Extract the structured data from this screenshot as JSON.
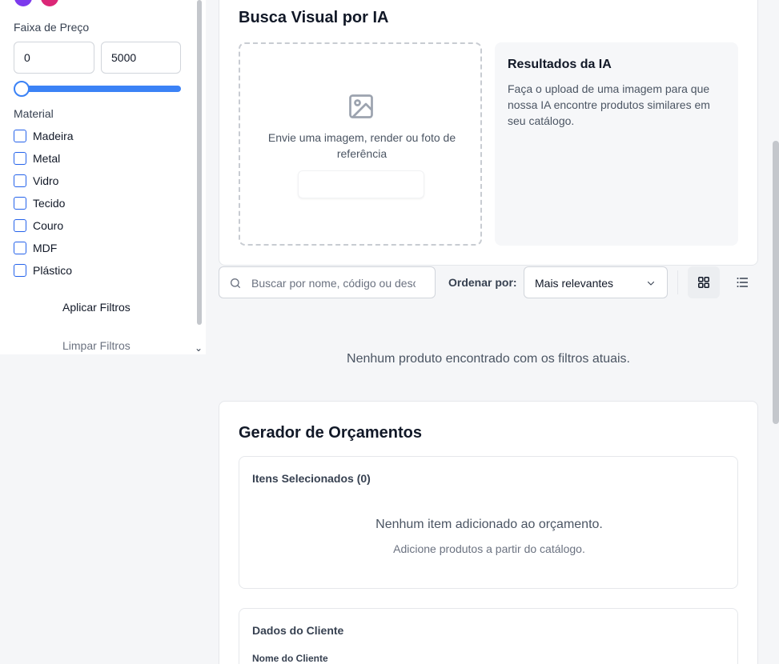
{
  "sidebar": {
    "price_range_label": "Faixa de Preço",
    "price_min": "0",
    "price_max": "5000",
    "price_slider_position": 0,
    "material_label": "Material",
    "materials": [
      "Madeira",
      "Metal",
      "Vidro",
      "Tecido",
      "Couro",
      "MDF",
      "Plástico"
    ],
    "apply_button": "Aplicar Filtros",
    "clear_button": "Limpar Filtros",
    "swatch_colors": [
      "#7c3aed",
      "#db2777"
    ]
  },
  "ai_search": {
    "title": "Busca Visual por IA",
    "upload_text": "Envie uma imagem, render ou foto de referência",
    "results_title": "Resultados da IA",
    "results_text": "Faça o upload de uma imagem para que nossa IA encontre produtos similares em seu catálogo."
  },
  "toolbar": {
    "search_placeholder": "Buscar por nome, código ou descrição",
    "sort_label": "Ordenar por:",
    "sort_value": "Mais relevantes",
    "active_view": "grid"
  },
  "products": {
    "empty_message": "Nenhum produto encontrado com os filtros atuais."
  },
  "quote": {
    "title": "Gerador de Orçamentos",
    "selected_items_title": "Itens Selecionados (0)",
    "empty_main": "Nenhum item adicionado ao orçamento.",
    "empty_sub": "Adicione produtos a partir do catálogo.",
    "client_title": "Dados do Cliente",
    "client_name_label": "Nome do Cliente"
  },
  "colors": {
    "accent": "#3b82f6",
    "checkbox": "#2563eb"
  }
}
